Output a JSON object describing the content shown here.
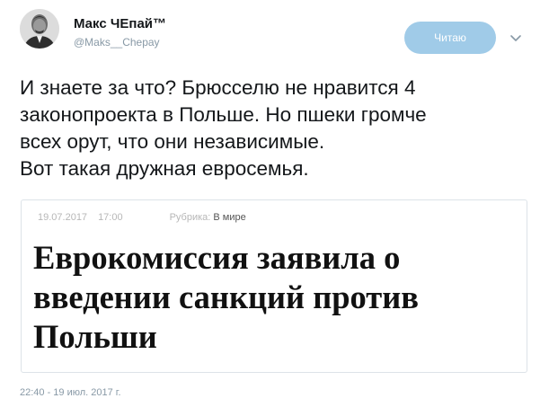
{
  "author": {
    "display_name": "Макс ЧЕпай™",
    "handle": "@Maks__Chepay",
    "avatar_icon": "person-photo-icon"
  },
  "follow_button": {
    "label": "Читаю"
  },
  "more_menu_icon": "chevron-down-icon",
  "tweet": {
    "text_lines": [
      "И знаете за что? Брюсселю не нравится 4",
      "законопроекта в Польше. Но пшеки громче",
      "всех орут, что они независимые.",
      "Вот такая дружная евросемья."
    ],
    "timestamp": "22:40 - 19 июл. 2017 г."
  },
  "card": {
    "date": "19.07.2017",
    "time": "17:00",
    "rubric_label": "Рубрика:",
    "rubric_value": "В мире",
    "headline_lines": [
      "Еврокомиссия заявила о",
      "введении санкций против",
      "Польши"
    ]
  },
  "colors": {
    "follow_button_bg": "#a0cbe8",
    "muted_text": "#8899a6",
    "card_border": "#dde3e8"
  }
}
